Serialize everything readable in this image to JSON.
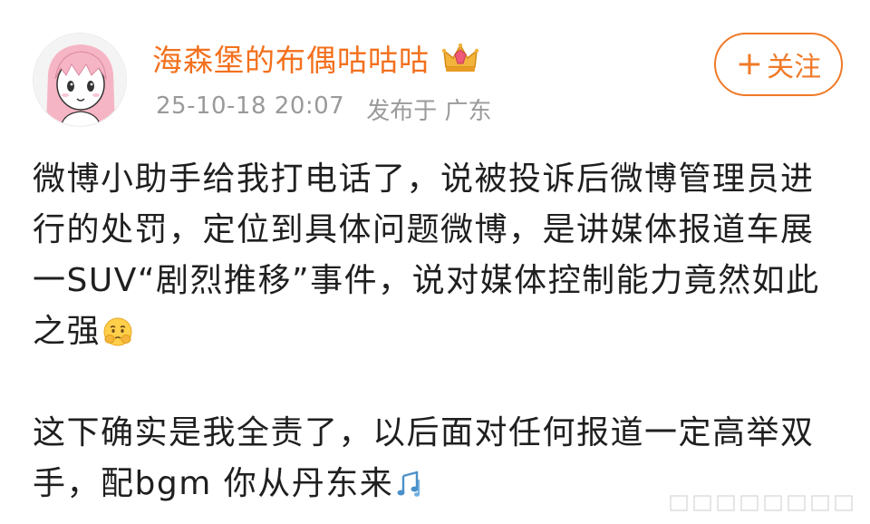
{
  "user": {
    "name": "海森堡的布偶咕咕咕",
    "badge_icon": "crown-badge-icon",
    "avatar_icon": "anime-girl-avatar-icon"
  },
  "meta": {
    "time": "25-10-18 20:07",
    "location": "发布于 广东"
  },
  "follow_button": {
    "plus": "+",
    "label": "关注"
  },
  "post": {
    "paragraph_1": "微博小助手给我打电话了，说被投诉后微博管理员进行的处罚，定位到具体问题微博，是讲媒体报道车展一SUV“剧烈推移”事件，说对媒体控制能力竟然如此之强",
    "emoji_1": "worried-face-emoji-icon",
    "paragraph_2": "这下确实是我全责了，以后面对任何报道一定高举双手，配bgm 你从丹东来",
    "emoji_2": "music-notes-emoji-icon"
  },
  "colors": {
    "username": "#f3701d",
    "follow": "#f07a28",
    "meta": "#9a9a9a",
    "text": "#1f1f1f"
  }
}
